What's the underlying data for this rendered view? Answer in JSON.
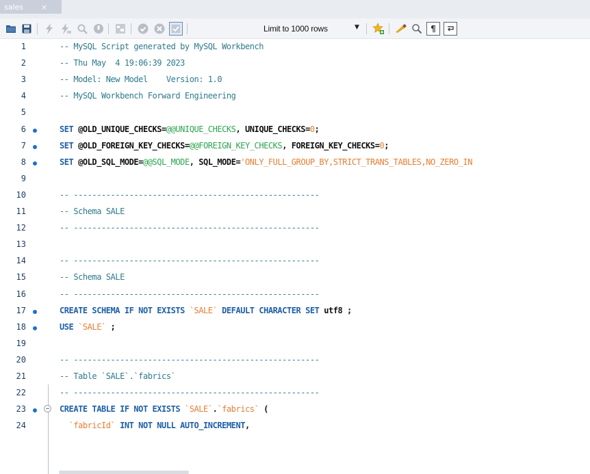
{
  "tab": {
    "label": "sales",
    "close": "×"
  },
  "toolbar": {
    "limit_label": "Limit to 1000 rows",
    "limit_arrow": "▼"
  },
  "colors": {
    "comment": "#2e7a8c",
    "keyword": "#1f5fa6",
    "system_var": "#2da44e",
    "string": "#e87d32",
    "statement_dot": "#1e6fcf"
  },
  "editor": {
    "lines": [
      {
        "n": "1",
        "dot": false,
        "fold": false,
        "tokens": [
          {
            "t": "-- MySQL Script generated by MySQL Workbench",
            "c": "comment"
          }
        ]
      },
      {
        "n": "2",
        "dot": false,
        "fold": false,
        "tokens": [
          {
            "t": "-- Thu May  4 19:06:39 2023",
            "c": "comment"
          }
        ]
      },
      {
        "n": "3",
        "dot": false,
        "fold": false,
        "tokens": [
          {
            "t": "-- Model: New Model    Version: 1.0",
            "c": "comment"
          }
        ]
      },
      {
        "n": "4",
        "dot": false,
        "fold": false,
        "tokens": [
          {
            "t": "-- MySQL Workbench Forward Engineering",
            "c": "comment"
          }
        ]
      },
      {
        "n": "5",
        "dot": false,
        "fold": false,
        "tokens": []
      },
      {
        "n": "6",
        "dot": true,
        "fold": false,
        "tokens": [
          {
            "t": "SET ",
            "c": "kw"
          },
          {
            "t": "@OLD_UNIQUE_CHECKS=",
            "c": "var"
          },
          {
            "t": "@@UNIQUE_CHECKS",
            "c": "sys"
          },
          {
            "t": ", UNIQUE_CHECKS=",
            "c": "var"
          },
          {
            "t": "0",
            "c": "num"
          },
          {
            "t": ";",
            "c": "var"
          }
        ]
      },
      {
        "n": "7",
        "dot": true,
        "fold": false,
        "tokens": [
          {
            "t": "SET ",
            "c": "kw"
          },
          {
            "t": "@OLD_FOREIGN_KEY_CHECKS=",
            "c": "var"
          },
          {
            "t": "@@FOREIGN_KEY_CHECKS",
            "c": "sys"
          },
          {
            "t": ", FOREIGN_KEY_CHECKS=",
            "c": "var"
          },
          {
            "t": "0",
            "c": "num"
          },
          {
            "t": ";",
            "c": "var"
          }
        ]
      },
      {
        "n": "8",
        "dot": true,
        "fold": false,
        "tokens": [
          {
            "t": "SET ",
            "c": "kw"
          },
          {
            "t": "@OLD_SQL_MODE=",
            "c": "var"
          },
          {
            "t": "@@SQL_MODE",
            "c": "sys"
          },
          {
            "t": ", SQL_MODE=",
            "c": "var"
          },
          {
            "t": "'ONLY_FULL_GROUP_BY,STRICT_TRANS_TABLES,NO_ZERO_IN",
            "c": "str"
          }
        ]
      },
      {
        "n": "9",
        "dot": false,
        "fold": false,
        "tokens": []
      },
      {
        "n": "10",
        "dot": false,
        "fold": false,
        "tokens": [
          {
            "t": "-- -----------------------------------------------------",
            "c": "comment"
          }
        ]
      },
      {
        "n": "11",
        "dot": false,
        "fold": false,
        "tokens": [
          {
            "t": "-- Schema SALE",
            "c": "comment"
          }
        ]
      },
      {
        "n": "12",
        "dot": false,
        "fold": false,
        "tokens": [
          {
            "t": "-- -----------------------------------------------------",
            "c": "comment"
          }
        ]
      },
      {
        "n": "13",
        "dot": false,
        "fold": false,
        "tokens": []
      },
      {
        "n": "14",
        "dot": false,
        "fold": false,
        "tokens": [
          {
            "t": "-- -----------------------------------------------------",
            "c": "comment"
          }
        ]
      },
      {
        "n": "15",
        "dot": false,
        "fold": false,
        "tokens": [
          {
            "t": "-- Schema SALE",
            "c": "comment"
          }
        ]
      },
      {
        "n": "16",
        "dot": false,
        "fold": false,
        "tokens": [
          {
            "t": "-- -----------------------------------------------------",
            "c": "comment"
          }
        ]
      },
      {
        "n": "17",
        "dot": true,
        "fold": false,
        "tokens": [
          {
            "t": "CREATE SCHEMA IF NOT EXISTS ",
            "c": "kw"
          },
          {
            "t": "`SALE`",
            "c": "str"
          },
          {
            "t": " DEFAULT CHARACTER SET ",
            "c": "kw"
          },
          {
            "t": "utf8 ;",
            "c": "plain"
          }
        ]
      },
      {
        "n": "18",
        "dot": true,
        "fold": false,
        "tokens": [
          {
            "t": "USE ",
            "c": "kw"
          },
          {
            "t": "`SALE`",
            "c": "str"
          },
          {
            "t": " ;",
            "c": "plain"
          }
        ]
      },
      {
        "n": "19",
        "dot": false,
        "fold": false,
        "tokens": []
      },
      {
        "n": "20",
        "dot": false,
        "fold": false,
        "tokens": [
          {
            "t": "-- -----------------------------------------------------",
            "c": "comment"
          }
        ]
      },
      {
        "n": "21",
        "dot": false,
        "fold": false,
        "tokens": [
          {
            "t": "-- Table `SALE`.`fabrics`",
            "c": "comment"
          }
        ]
      },
      {
        "n": "22",
        "dot": false,
        "fold": false,
        "tokens": [
          {
            "t": "-- -----------------------------------------------------",
            "c": "comment"
          }
        ]
      },
      {
        "n": "23",
        "dot": true,
        "fold": true,
        "tokens": [
          {
            "t": "CREATE TABLE IF NOT EXISTS ",
            "c": "kw"
          },
          {
            "t": "`SALE`",
            "c": "str"
          },
          {
            "t": ".",
            "c": "plain"
          },
          {
            "t": "`fabrics`",
            "c": "str"
          },
          {
            "t": " (",
            "c": "plain"
          }
        ]
      },
      {
        "n": "24",
        "dot": false,
        "fold": false,
        "tokens": [
          {
            "t": "  `fabricId` ",
            "c": "str"
          },
          {
            "t": "INT NOT NULL AUTO_INCREMENT",
            "c": "kw"
          },
          {
            "t": ",",
            "c": "plain"
          }
        ]
      }
    ]
  }
}
